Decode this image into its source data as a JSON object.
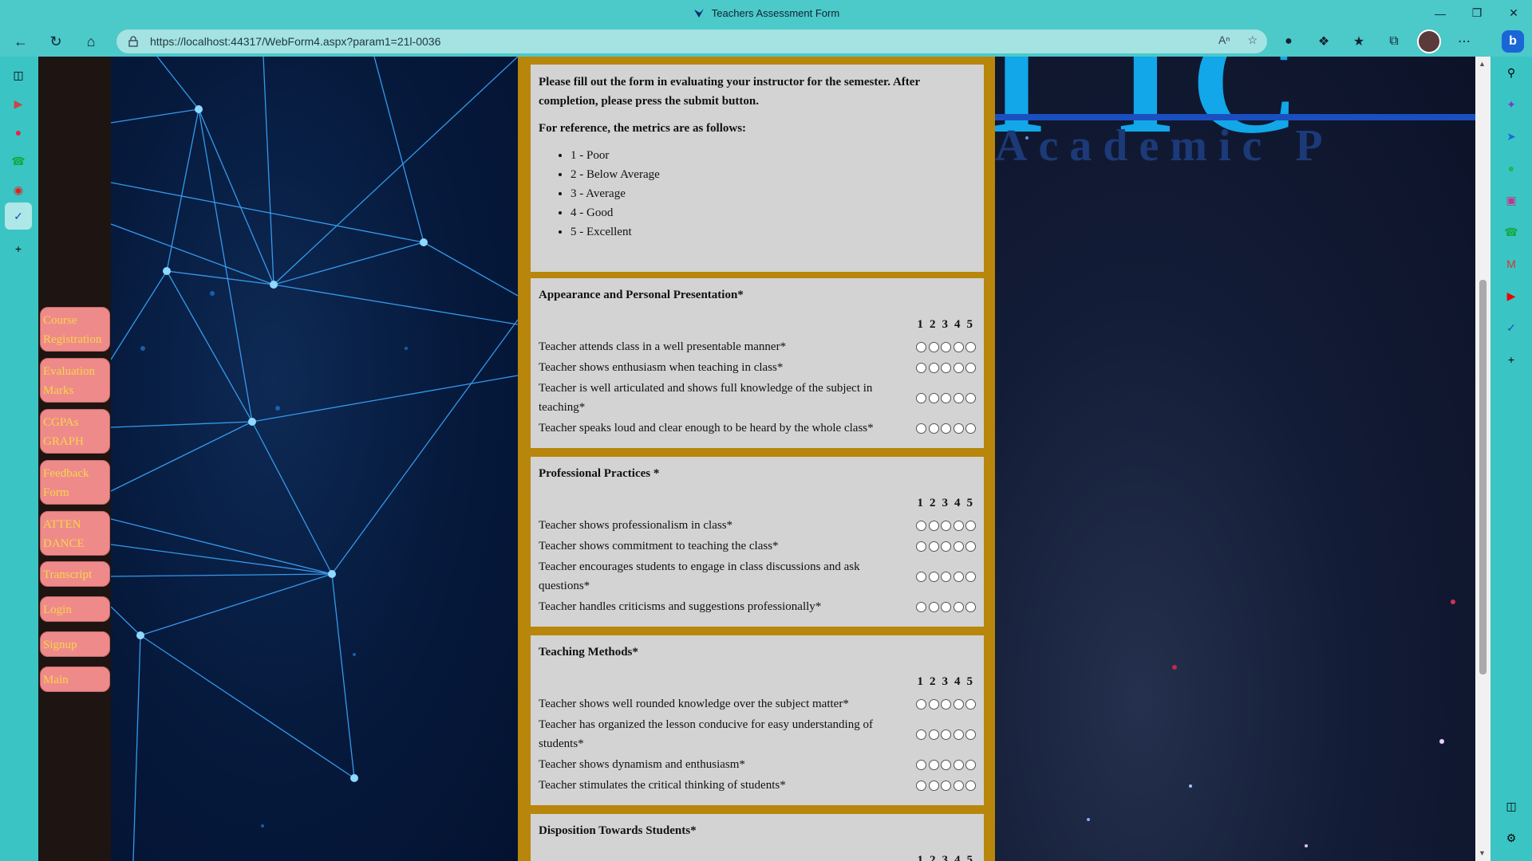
{
  "window": {
    "title": "Teachers Assessment Form"
  },
  "browser": {
    "url": "https://localhost:44317/WebForm4.aspx?param1=21l-0036"
  },
  "nav": [
    "Course Registration",
    "Evaluation Marks",
    "CGPAs GRAPH",
    "Feedback Form",
    "ATTEN DANCE",
    "Transcript",
    "Login",
    "Signup",
    "Main"
  ],
  "banner": {
    "big": "I IC",
    "sub": "Academic P"
  },
  "intro": {
    "p1": "Please fill out the form in evaluating your instructor for the semester. After completion, please press the submit button.",
    "p2": "For reference, the metrics are as follows:",
    "metrics": [
      "1 - Poor",
      "2 - Below Average",
      "3 - Average",
      "4 - Good",
      "5 - Excellent"
    ]
  },
  "scale": [
    "1",
    "2",
    "3",
    "4",
    "5"
  ],
  "sections": [
    {
      "title": "Appearance and Personal Presentation*",
      "questions": [
        "Teacher attends class in a well presentable manner*",
        "Teacher shows enthusiasm when teaching in class*",
        "Teacher is well articulated and shows full knowledge of the subject in teaching*",
        "Teacher speaks loud and clear enough to be heard by the whole class*"
      ]
    },
    {
      "title": "Professional Practices *",
      "questions": [
        "Teacher shows professionalism in class*",
        "Teacher shows commitment to teaching the class*",
        "Teacher encourages students to engage in class discussions and ask questions*",
        "Teacher handles criticisms and suggestions professionally*"
      ]
    },
    {
      "title": "Teaching Methods*",
      "questions": [
        "Teacher shows well rounded knowledge over the subject matter*",
        "Teacher has organized the lesson conducive for easy understanding of students*",
        "Teacher shows dynamism and enthusiasm*",
        "Teacher stimulates the critical thinking of students*"
      ]
    },
    {
      "title": "Disposition Towards Students*",
      "questions": []
    }
  ]
}
